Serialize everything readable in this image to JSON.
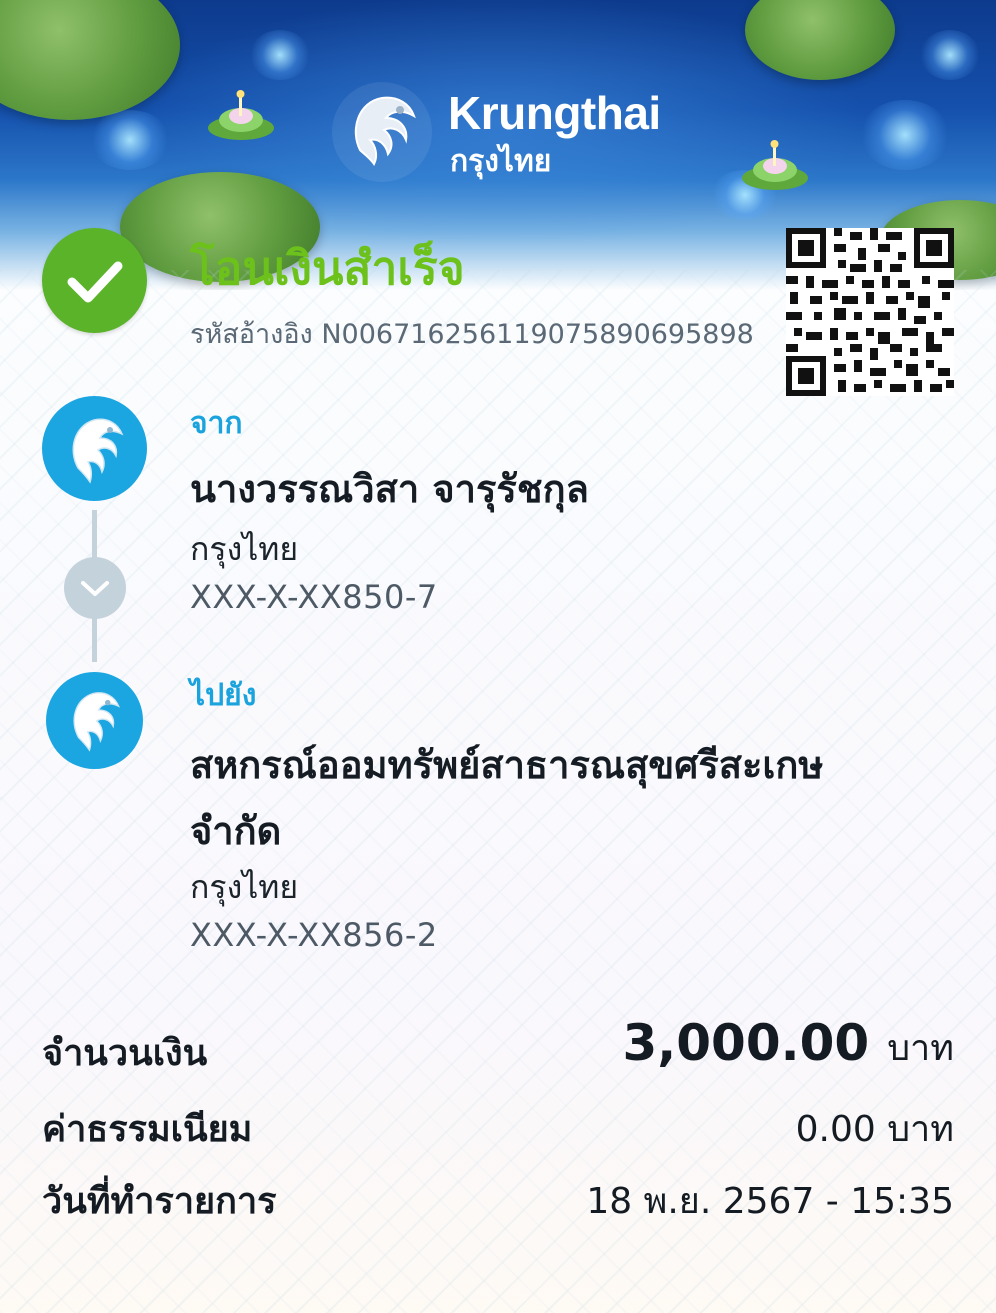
{
  "header": {
    "brand_en": "Krungthai",
    "brand_th": "กรุงไทย"
  },
  "status": {
    "title": "โอนเงินสำเร็จ",
    "ref_label": "รหัสอ้างอิง",
    "ref_code": "N006716256119075890695898",
    "icon": "check-icon",
    "color": "#5bb32a"
  },
  "from": {
    "label": "จาก",
    "name": "นางวรรณวิสา จารุรัชกุล",
    "bank": "กรุงไทย",
    "account": "XXX-X-XX850-7"
  },
  "to": {
    "label": "ไปยัง",
    "name_line1": "สหกรณ์ออมทรัพย์สาธารณสุขศรีสะเกษ",
    "name_line2": "จำกัด",
    "bank": "กรุงไทย",
    "account": "XXX-X-XX856-2"
  },
  "summary": {
    "amount_label": "จำนวนเงิน",
    "amount_value": "3,000.00",
    "amount_unit": "บาท",
    "fee_label": "ค่าธรรมเนียม",
    "fee_value": "0.00 บาท",
    "date_label": "วันที่ทำรายการ",
    "date_value": "18 พ.ย. 2567 - 15:35"
  },
  "colors": {
    "accent_blue": "#1aa3dd",
    "success_green": "#6cc11b",
    "connector_gray": "#c4d2dc"
  }
}
